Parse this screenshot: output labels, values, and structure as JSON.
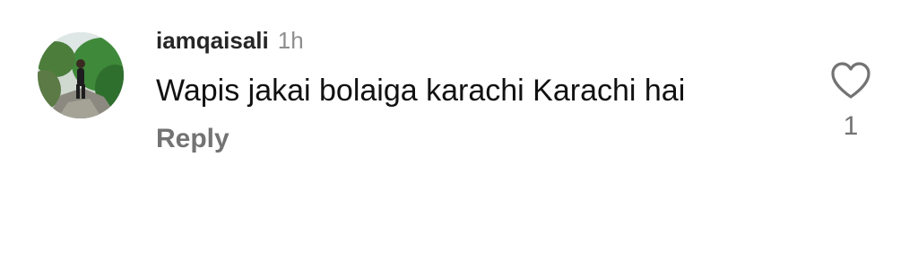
{
  "comment": {
    "username": "iamqaisali",
    "time_ago": "1h",
    "text": "Wapis jakai bolaiga karachi Karachi hai",
    "reply_label": "Reply",
    "like_count": "1",
    "like_icon": "heart-outline-icon"
  },
  "colors": {
    "username": "#262626",
    "secondary": "#8e8e8e",
    "reply": "#737373",
    "text": "#111111"
  }
}
